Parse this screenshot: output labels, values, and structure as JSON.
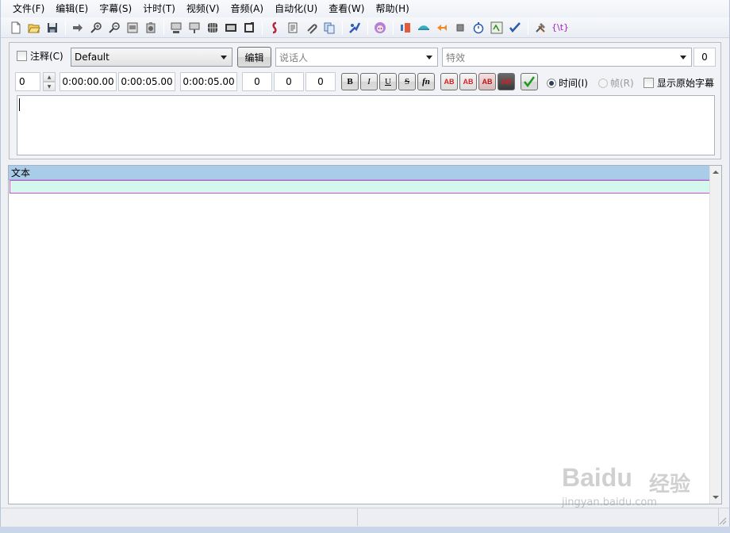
{
  "menubar": {
    "items": [
      "文件(F)",
      "编辑(E)",
      "字幕(S)",
      "计时(T)",
      "视频(V)",
      "音频(A)",
      "自动化(U)",
      "查看(W)",
      "帮助(H)"
    ]
  },
  "toolbar": {
    "buttons": [
      "new-file",
      "open-file",
      "save-file",
      "jump-to",
      "zoom-in",
      "zoom-out",
      "snapshot",
      "snapshot-clipboard",
      "jump-video-to-start",
      "jump-video-to-end",
      "timing-grid",
      "video-details",
      "zoom-video",
      "style-manager",
      "properties",
      "attachments",
      "fonts-collector",
      "automation",
      "translation-assistant",
      "styling-assistant",
      "resample",
      "timing-postprocessor",
      "kanji-timer",
      "spell-checker",
      "options",
      "lua-tag"
    ],
    "tag_label": "{\\t}"
  },
  "editor": {
    "comment_label": "注释(C)",
    "style_value": "Default",
    "edit_button": "编辑",
    "actor_placeholder": "说话人",
    "effect_placeholder": "特效",
    "layer_value": "0",
    "layer_spin_value": "0",
    "start_time": "0:00:00.00",
    "end_time": "0:00:05.00",
    "duration": "0:00:05.00",
    "margin_left": "0",
    "margin_right": "0",
    "margin_vertical": "0",
    "bold_label": "B",
    "italic_label": "I",
    "underline_label": "U",
    "strike_label": "S",
    "font_label": "fn",
    "color_labels": [
      "AB",
      "AB",
      "AB",
      "AB"
    ],
    "time_radio_label": "时间(I)",
    "frame_radio_label": "帧(R)",
    "show_original_label": "显示原始字幕",
    "text_value": ""
  },
  "grid": {
    "columns": [
      "文本"
    ],
    "rows": [
      ""
    ]
  },
  "colors": {
    "header": "#a9cde8",
    "selected_row": "#d5f8ee",
    "row_border": "#d14fcf"
  },
  "watermark": {
    "brand": "Baidu",
    "brand_cn": "经验",
    "url": "jingyan.baidu.com"
  }
}
